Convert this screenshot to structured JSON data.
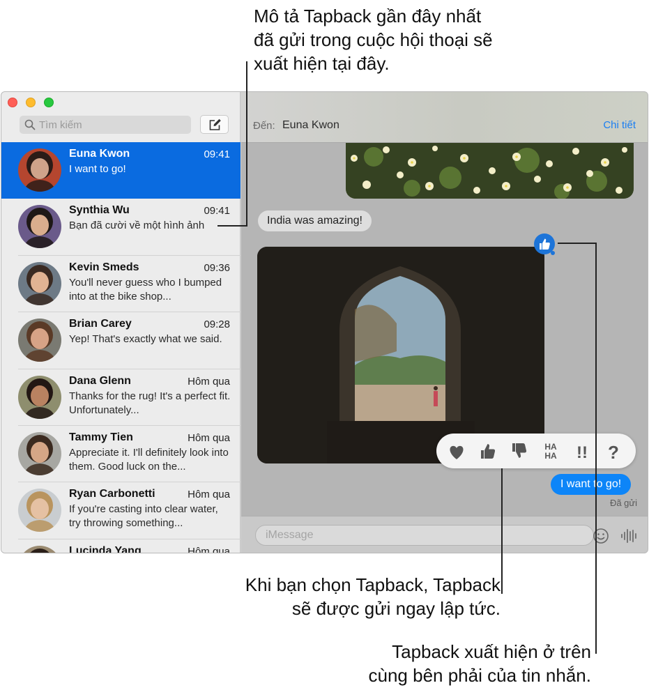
{
  "callouts": {
    "top": [
      "Mô tả Tapback gần đây nhất",
      "đã gửi trong cuộc hội thoại sẽ",
      "xuất hiện tại đây."
    ],
    "middle": [
      "Khi bạn chọn Tapback, Tapback",
      "sẽ được gửi ngay lập tức."
    ],
    "bottom": [
      "Tapback xuất hiện ở trên",
      "cùng bên phải của tin nhắn."
    ]
  },
  "sidebar": {
    "search_placeholder": "Tìm kiếm",
    "conversations": [
      {
        "name": "Euna Kwon",
        "time": "09:41",
        "preview": "I want to go!",
        "selected": true
      },
      {
        "name": "Synthia Wu",
        "time": "09:41",
        "preview": "Bạn đã cười về một hình ảnh"
      },
      {
        "name": "Kevin Smeds",
        "time": "09:36",
        "preview": "You'll never guess who I bumped into at the bike shop..."
      },
      {
        "name": "Brian Carey",
        "time": "09:28",
        "preview": "Yep! That's exactly what we said."
      },
      {
        "name": "Dana Glenn",
        "time": "Hôm qua",
        "preview": "Thanks for the rug! It's a perfect fit. Unfortunately..."
      },
      {
        "name": "Tammy Tien",
        "time": "Hôm qua",
        "preview": "Appreciate it. I'll definitely look into them. Good luck on the..."
      },
      {
        "name": "Ryan Carbonetti",
        "time": "Hôm qua",
        "preview": "If you're casting into clear water, try throwing something..."
      },
      {
        "name": "Lucinda Yang",
        "time": "Hôm qua",
        "preview": ""
      }
    ]
  },
  "chat": {
    "to_label": "Đến:",
    "to_name": "Euna Kwon",
    "details_label": "Chi tiết",
    "received_message": "India was amazing!",
    "sent_message": "I want to go!",
    "sent_status": "Đã gửi",
    "input_placeholder": "iMessage",
    "tapback_options": [
      "heart",
      "thumbs-up",
      "thumbs-down",
      "haha",
      "exclamation",
      "question"
    ]
  },
  "colors": {
    "selected_row": "#0a6be0",
    "sent_bubble": "#0d85f8",
    "link": "#1a7ef2",
    "tapback_badge": "#1d74d8"
  }
}
